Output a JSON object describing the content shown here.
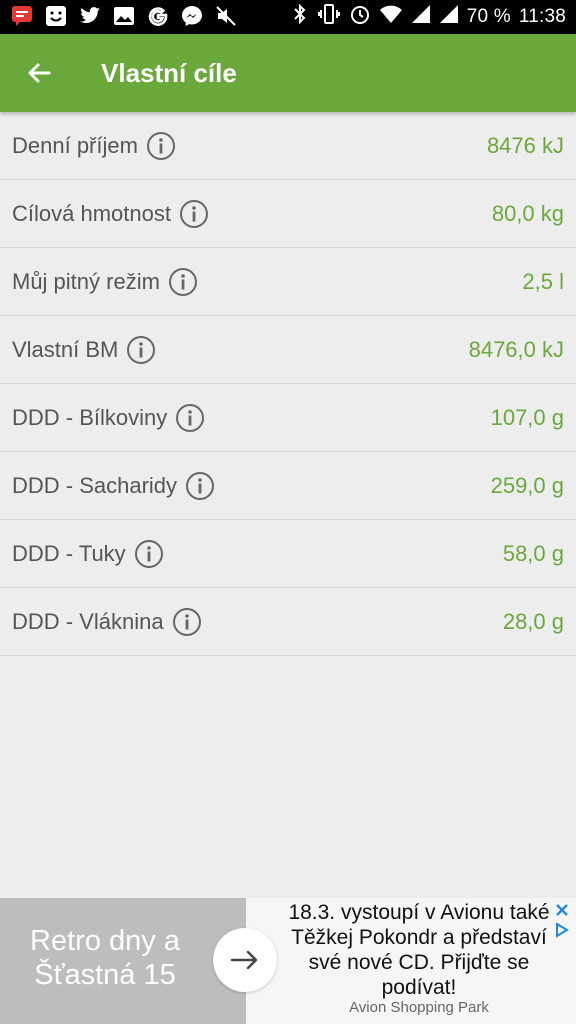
{
  "status_bar": {
    "notification_icons": [
      "message-icon",
      "smiley-icon",
      "twitter-icon",
      "image-icon",
      "google-icon",
      "messenger-icon",
      "mute-icon"
    ],
    "battery": "70 %",
    "time": "11:38"
  },
  "app_bar": {
    "title": "Vlastní cíle",
    "back_icon": "arrow-left-icon"
  },
  "goals": [
    {
      "label": "Denní příjem",
      "value": "8476 kJ"
    },
    {
      "label": "Cílová hmotnost",
      "value": "80,0 kg"
    },
    {
      "label": "Můj pitný režim",
      "value": "2,5 l"
    },
    {
      "label": "Vlastní BM",
      "value": "8476,0 kJ"
    },
    {
      "label": "DDD - Bílkoviny",
      "value": "107,0 g"
    },
    {
      "label": "DDD - Sacharidy",
      "value": "259,0 g"
    },
    {
      "label": "DDD - Tuky",
      "value": "58,0 g"
    },
    {
      "label": "DDD - Vláknina",
      "value": "28,0 g"
    }
  ],
  "ad": {
    "left_text": "Retro dny a Šťastná 15",
    "right_text": "18.3. vystoupí v Avionu také Těžkej Pokondr a představí své nové CD. Přijďte se podívat!",
    "source": "Avion Shopping Park"
  },
  "colors": {
    "accent": "#6aa83b",
    "label": "#555555",
    "background": "#ededed"
  }
}
